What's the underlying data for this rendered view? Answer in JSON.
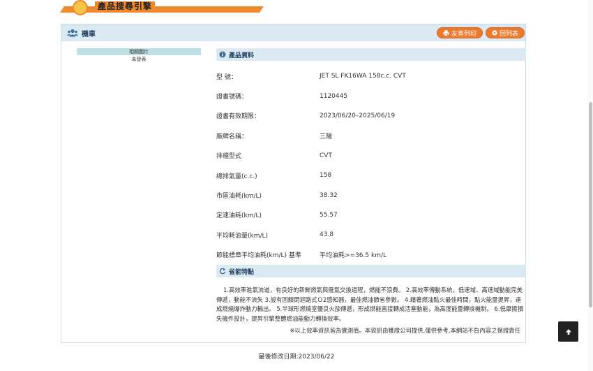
{
  "banner": {
    "title": "產品搜尋引擎"
  },
  "card": {
    "title": "機車",
    "print_label": "友善列印",
    "back_label": "回列表"
  },
  "image": {
    "label": "相關圖片",
    "status": "未發表"
  },
  "product_section": {
    "title": "產品資料"
  },
  "specs": [
    {
      "key": "型 號：",
      "value": "JET SL FK16WA 158c.c. CVT"
    },
    {
      "key": "證書號碼：",
      "value": "1120445"
    },
    {
      "key": "證書有效期限：",
      "value": "2023/06/20–2025/06/19"
    },
    {
      "key": "廠牌名稱：",
      "value": "三陽"
    },
    {
      "key": "排檔型式",
      "value": "CVT"
    },
    {
      "key": "總排氣量(c.c.)",
      "value": "158"
    },
    {
      "key": "市區油耗(km/L)",
      "value": "38.32"
    },
    {
      "key": "定速油耗(km/L)",
      "value": "55.57"
    },
    {
      "key": "平均耗油量(km/L)",
      "value": "43.8"
    },
    {
      "key": "節能標章平均油耗(km/L) 基準",
      "value": "平均油耗>=36.5 km/L"
    }
  ],
  "features_section": {
    "title": "省能特點"
  },
  "features_text": "1.高效率進氣流道，有良好的新鮮燃氣與廢氣交換過程，燃能不浪費。 2.高效率傳動系統，低速域、高速域動能完美傳遞，動能不流失 3.設有回饋閉迴路式Ｏ2感知器，最佳燃油節省參數。 4.藉著燃油點火最佳時間，點火能量提昇，達成燃燒爆炸動力輸出。 5.半球形燃燒室優良火燄傳遞，形成燃能直接轉成活塞動能，為高度能量轉換機制。 6.低摩擦損失機件設計，提昇引擎整體燃油能動力轉換效率。",
  "disclaimer": "※以上效率資訊皆為實測值。本資訊由獲證公司提供,僅供參考,本網站不負內容之保證責任",
  "modified": "最後修改日期:2023/06/22",
  "totop_icon": "arrow-up-icon"
}
